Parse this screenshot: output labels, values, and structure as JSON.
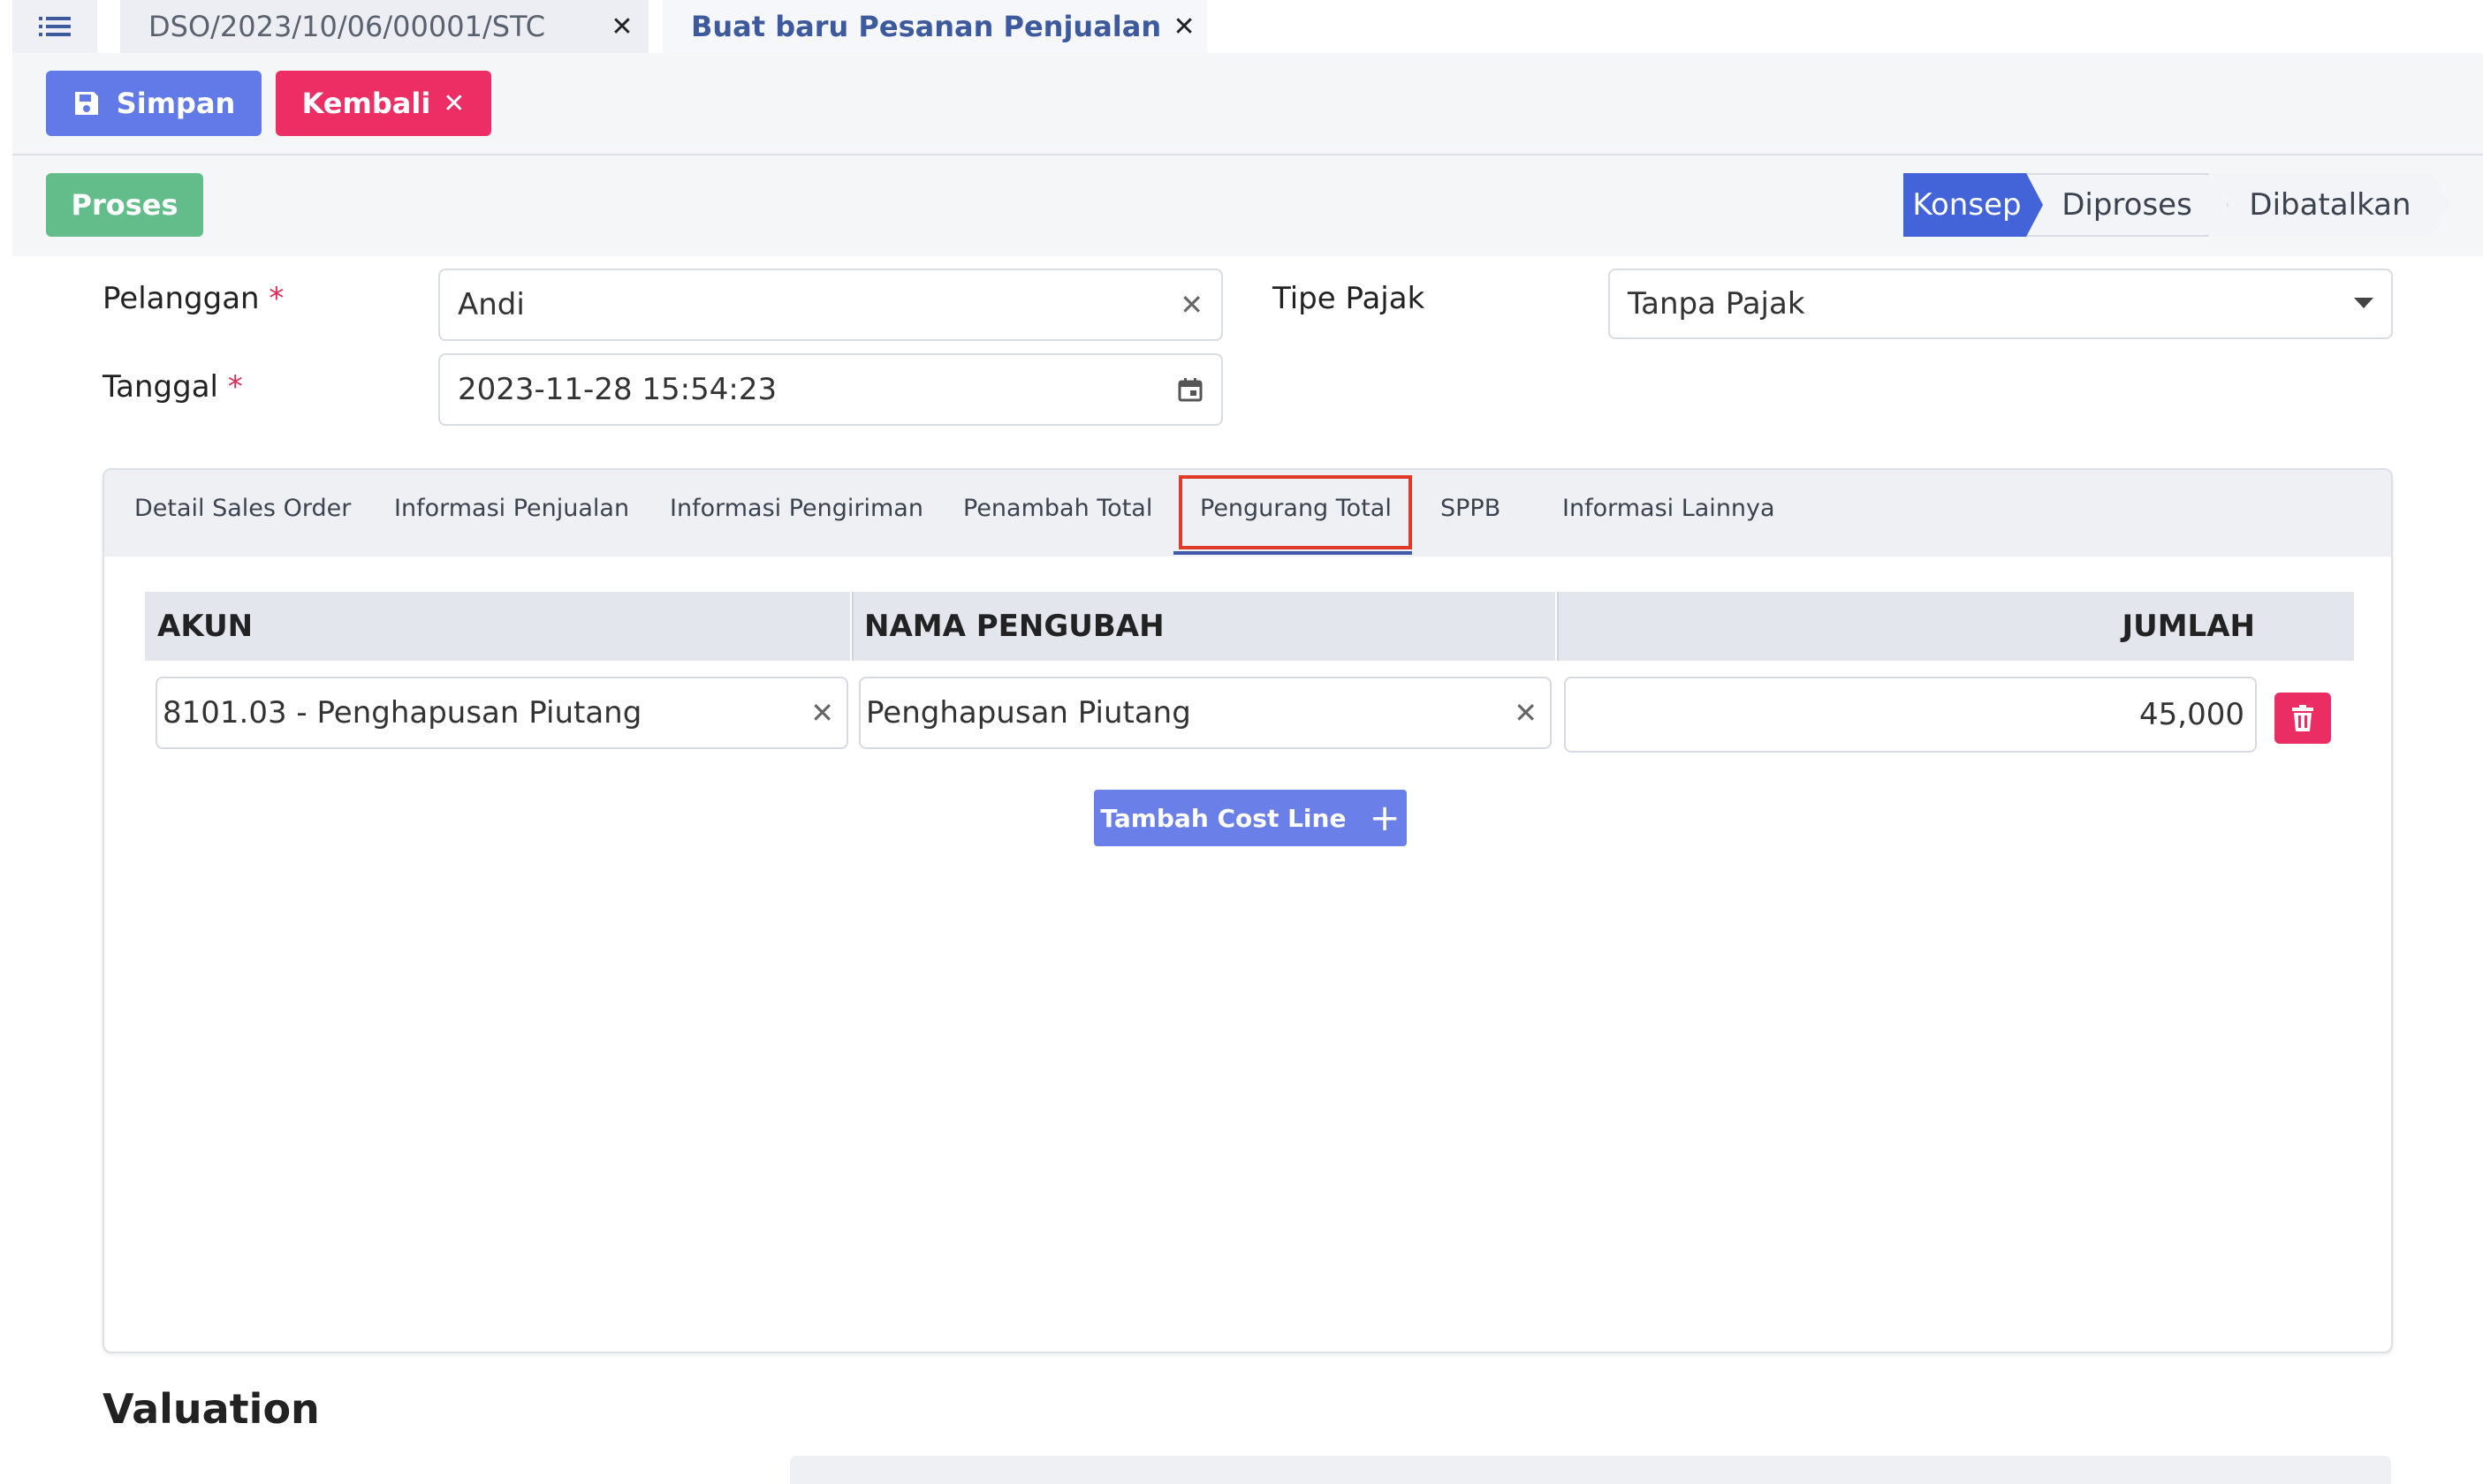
{
  "tabs": [
    {
      "label": "DSO/2023/10/06/00001/STC",
      "active": false
    },
    {
      "label": "Buat baru Pesanan Penjualan",
      "active": true
    }
  ],
  "toolbar": {
    "save_label": "Simpan",
    "back_label": "Kembali"
  },
  "status": {
    "proses_label": "Proses",
    "stages": [
      "Konsep",
      "Diproses",
      "Dibatalkan"
    ],
    "active_stage": "Konsep"
  },
  "form": {
    "customer_label": "Pelanggan",
    "customer_value": "Andi",
    "date_label": "Tanggal",
    "date_value": "2023-11-28 15:54:23",
    "tax_label": "Tipe Pajak",
    "tax_value": "Tanpa Pajak",
    "required_mark": "*"
  },
  "notebook": {
    "tabs": [
      "Detail Sales Order",
      "Informasi Penjualan",
      "Informasi Pengiriman",
      "Penambah Total",
      "Pengurang Total",
      "SPPB",
      "Informasi Lainnya"
    ],
    "active_tab": "Pengurang Total",
    "columns": [
      "AKUN",
      "NAMA PENGUBAH",
      "JUMLAH"
    ],
    "rows": [
      {
        "akun": "8101.03 - Penghapusan Piutang",
        "nama": "Penghapusan Piutang",
        "jumlah": "45,000"
      }
    ],
    "add_line_label": "Tambah Cost Line"
  },
  "valuation": {
    "title": "Valuation"
  },
  "colors": {
    "primary": "#6279e8",
    "danger": "#ec2e65",
    "success": "#62bd8a",
    "active_stage": "#4264d8",
    "highlight": "#e13a2b"
  }
}
